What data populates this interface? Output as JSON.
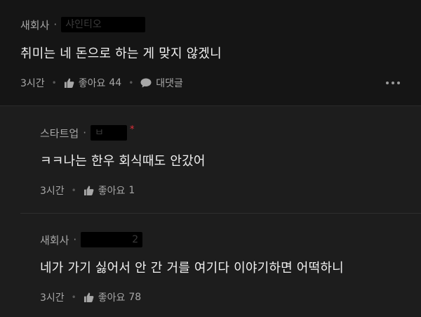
{
  "comments": [
    {
      "author": "새회사",
      "nickname": "샤인티오",
      "body": "취미는 네 돈으로 하는 게 맞지 않겠니",
      "time": "3시간",
      "like_label": "좋아요",
      "like_count": "44",
      "reply_label": "대댓글"
    }
  ],
  "replies": [
    {
      "author": "스타트업",
      "nickname": "ㅂ",
      "body": "ㅋㅋ나는 한우 회식때도 안갔어",
      "time": "3시간",
      "like_label": "좋아요",
      "like_count": "1"
    },
    {
      "author": "새회사",
      "nickname": "2",
      "body": "네가 가기 싫어서 안 간 거를 여기다 이야기하면 어떡하니",
      "time": "3시간",
      "like_label": "좋아요",
      "like_count": "78"
    }
  ],
  "icons": {
    "like": "thumbs-up-icon",
    "reply": "speech-bubble-icon",
    "more": "more-dots-icon"
  },
  "colors": {
    "background": "#151515",
    "reply_background": "#1d1d1d",
    "text": "#f0f0f0",
    "meta": "#a7a7a7",
    "verified_star": "#e0303a"
  }
}
